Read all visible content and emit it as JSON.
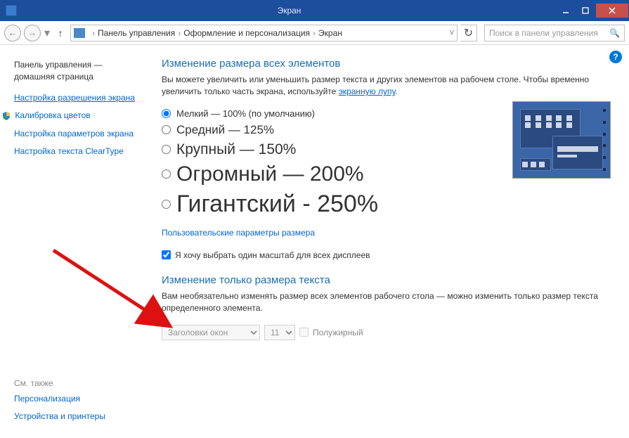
{
  "window": {
    "title": "Экран"
  },
  "breadcrumb": {
    "root": "Панель управления",
    "mid": "Оформление и персонализация",
    "leaf": "Экран",
    "dropdown_glyph": "ᐯ"
  },
  "search": {
    "placeholder": "Поиск в панели управления"
  },
  "sidebar": {
    "home1": "Панель управления —",
    "home2": "домашняя страница",
    "link_resolution": "Настройка разрешения экрана",
    "link_calibration": "Калибровка цветов",
    "link_display_params": "Настройка параметров экрана",
    "link_cleartype": "Настройка текста ClearType",
    "see_also": "См. также",
    "link_personalization": "Персонализация",
    "link_devices": "Устройства и принтеры"
  },
  "main": {
    "heading1": "Изменение размера всех элементов",
    "desc1_a": "Вы можете увеличить или уменьшить размер текста и других элементов на рабочем столе. Чтобы временно увеличить только часть экрана, используйте ",
    "desc1_link": "экранную лупу",
    "desc1_b": ".",
    "radios": {
      "small": "Мелкий — 100% (по умолчанию)",
      "medium": "Средний — 125%",
      "large": "Крупный — 150%",
      "xl": "Огромный — 200%",
      "xxl": "Гигантский - 250%"
    },
    "custom_link": "Пользовательские параметры размера",
    "checkbox_label": "Я хочу выбрать один масштаб для всех дисплеев",
    "heading2": "Изменение только размера текста",
    "desc2": "Вам необязательно изменять размер всех элементов рабочего стола — можно изменить только размер текста определенного элемента.",
    "select_element": "Заголовки окон",
    "select_size": "11",
    "bold_label": "Полужирный"
  }
}
